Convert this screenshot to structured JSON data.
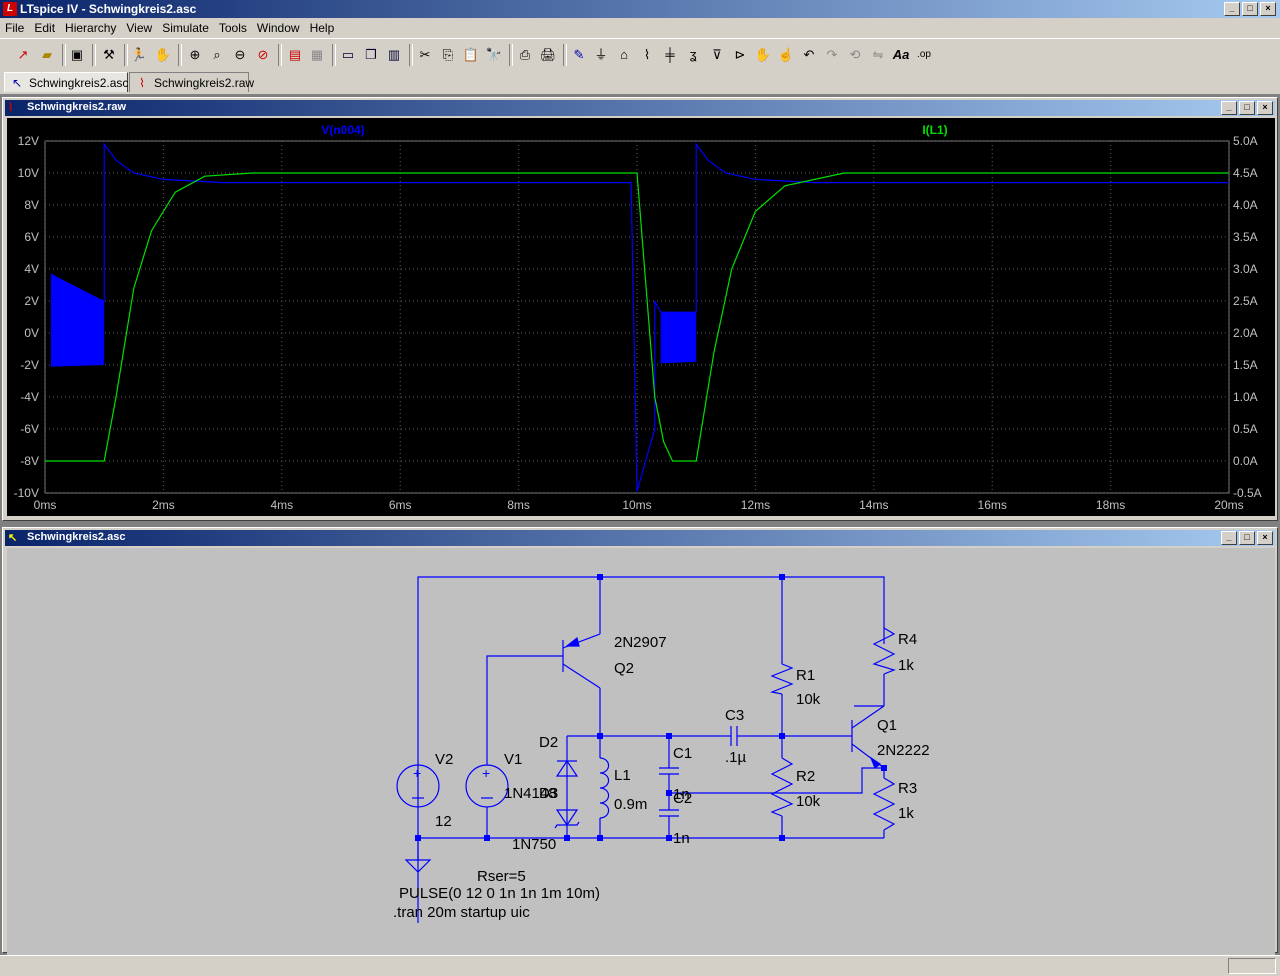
{
  "app": {
    "title": "LTspice IV - Schwingkreis2.asc"
  },
  "menu": [
    "File",
    "Edit",
    "Hierarchy",
    "View",
    "Simulate",
    "Tools",
    "Window",
    "Help"
  ],
  "toolbar_icons": [
    "new-schematic-icon",
    "open-icon",
    "save-icon",
    "hammer-icon",
    "run-icon",
    "halt-icon",
    "zoom-in-icon",
    "zoom-pan-icon",
    "zoom-out-icon",
    "zoom-fit-icon",
    "autorange-icon",
    "fit-icon",
    "tile-horizontal-icon",
    "cascade-icon",
    "tile-vertical-icon",
    "cut-icon",
    "copy-icon",
    "paste-icon",
    "find-icon",
    "print-setup-icon",
    "print-icon",
    "wire-icon",
    "ground-icon",
    "label-net-icon",
    "resistor-icon",
    "capacitor-icon",
    "inductor-icon",
    "diode-icon",
    "component-icon",
    "move-icon",
    "drag-icon",
    "undo-icon",
    "redo-icon",
    "rotate-icon",
    "mirror-icon",
    "text-icon",
    "spice-directive-icon"
  ],
  "tabs": [
    {
      "label": "Schwingkreis2.asc",
      "icon": "schematic-icon"
    },
    {
      "label": "Schwingkreis2.raw",
      "icon": "waveform-icon"
    }
  ],
  "waveform_window": {
    "title": "Schwingkreis2.raw"
  },
  "schematic_window": {
    "title": "Schwingkreis2.asc"
  },
  "chart_data": {
    "type": "line",
    "title": "",
    "xlabel": "",
    "ylabel": "",
    "x_ticks": [
      "0ms",
      "2ms",
      "4ms",
      "6ms",
      "8ms",
      "10ms",
      "12ms",
      "14ms",
      "16ms",
      "18ms",
      "20ms"
    ],
    "y_left_ticks": [
      "12V",
      "10V",
      "8V",
      "6V",
      "4V",
      "2V",
      "0V",
      "-2V",
      "-4V",
      "-6V",
      "-8V",
      "-10V"
    ],
    "y_right_ticks": [
      "5.0A",
      "4.5A",
      "4.0A",
      "3.5A",
      "3.0A",
      "2.5A",
      "2.0A",
      "1.5A",
      "1.0A",
      "0.5A",
      "0.0A",
      "-0.5A"
    ],
    "xlim": [
      0,
      20
    ],
    "ylim_left": [
      -10,
      12
    ],
    "ylim_right": [
      -0.5,
      5.0
    ],
    "grid": true,
    "series": [
      {
        "name": "V(n004)",
        "axis": "left",
        "color": "#0000ff",
        "points": [
          [
            0.1,
            3.7
          ],
          [
            0.5,
            2.6
          ],
          [
            1.0,
            2.0
          ],
          [
            1.0,
            11.8
          ],
          [
            1.2,
            10.8
          ],
          [
            1.5,
            10.0
          ],
          [
            2.0,
            9.6
          ],
          [
            3.0,
            9.4
          ],
          [
            5.0,
            9.4
          ],
          [
            9.9,
            9.4
          ],
          [
            10.0,
            -9.9
          ],
          [
            10.3,
            -6.0
          ],
          [
            10.3,
            2.0
          ],
          [
            10.4,
            1.3
          ],
          [
            11.0,
            1.3
          ],
          [
            11.0,
            11.8
          ],
          [
            11.2,
            10.8
          ],
          [
            11.5,
            10.0
          ],
          [
            12.0,
            9.6
          ],
          [
            13.0,
            9.4
          ],
          [
            20.0,
            9.4
          ]
        ],
        "bursts": [
          {
            "x_from": 0.1,
            "x_to": 1.0,
            "top_from": 3.7,
            "top_to": 2.0,
            "bottom_from": -2.1,
            "bottom_to": -2.0
          },
          {
            "x_from": 10.4,
            "x_to": 11.0,
            "top_from": 1.3,
            "top_to": 1.3,
            "bottom_from": -1.9,
            "bottom_to": -1.8
          }
        ]
      },
      {
        "name": "I(L1)",
        "axis": "right",
        "color": "#00e000",
        "points": [
          [
            0,
            0.0
          ],
          [
            1.0,
            0.0
          ],
          [
            1.2,
            1.0
          ],
          [
            1.5,
            2.7
          ],
          [
            1.8,
            3.6
          ],
          [
            2.2,
            4.2
          ],
          [
            2.7,
            4.45
          ],
          [
            3.5,
            4.5
          ],
          [
            10.0,
            4.5
          ],
          [
            10.3,
            1.0
          ],
          [
            10.45,
            0.3
          ],
          [
            10.6,
            0.0
          ],
          [
            11.0,
            0.0
          ],
          [
            11.3,
            1.7
          ],
          [
            11.6,
            3.0
          ],
          [
            12.0,
            3.9
          ],
          [
            12.5,
            4.3
          ],
          [
            13.5,
            4.5
          ],
          [
            20.0,
            4.5
          ]
        ]
      }
    ]
  },
  "schematic": {
    "labels": {
      "q2_model": "2N2907",
      "q2": "Q2",
      "q1": "Q1",
      "q1_model": "2N2222",
      "r1": "R1",
      "r1_val": "10k",
      "r2": "R2",
      "r2_val": "10k",
      "r3": "R3",
      "r3_val": "1k",
      "r4": "R4",
      "r4_val": "1k",
      "c1": "C1",
      "c1_val": "1n",
      "c2": "C2",
      "c2_val": "1n",
      "c3": "C3",
      "c3_val": ".1µ",
      "l1": "L1",
      "l1_val": "0.9m",
      "d2": "D2",
      "d2_model": "1N4148",
      "d3": "D3",
      "d3_model": "1N750",
      "v1": "V1",
      "v2": "V2",
      "v2_val": "12",
      "v1_rser": "Rser=5",
      "v1_pulse": "PULSE(0 12 0 1n 1n 1m 10m)",
      "directive": ".tran 20m startup uic"
    }
  }
}
